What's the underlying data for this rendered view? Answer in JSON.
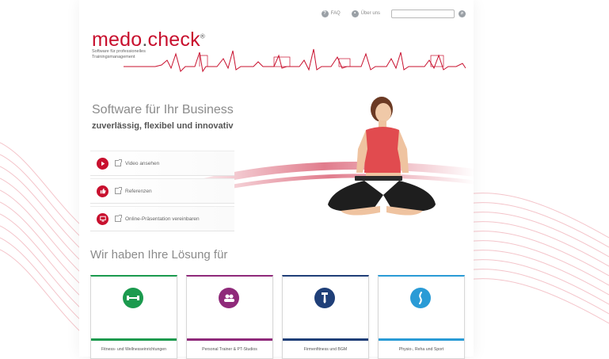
{
  "header": {
    "faq_label": "FAQ",
    "account_label": "Über uns",
    "search": {
      "value": "",
      "placeholder": ""
    }
  },
  "brand": {
    "logo_main": "medo",
    "logo_dot": ".",
    "logo_suffix": "check",
    "logo_mark": "®",
    "tagline_line1": "Software für professionelles",
    "tagline_line2": "Trainingsmanagement"
  },
  "hero": {
    "title": "Software für Ihr Business",
    "subtitle": "zuverlässig, flexibel und innovativ",
    "links": [
      {
        "label": "Video ansehen",
        "icon": "play-icon"
      },
      {
        "label": "Referenzen",
        "icon": "thumbs-up-icon"
      },
      {
        "label": "Online-Präsentation vereinbaren",
        "icon": "monitor-icon"
      }
    ]
  },
  "solutions": {
    "title": "Wir haben Ihre Lösung für",
    "cards": [
      {
        "label": "Fitness- und Wellnesseinrichtungen",
        "icon": "dumbbell-icon",
        "color": "#1b9a4e"
      },
      {
        "label": "Personal Trainer & PT-Studios",
        "icon": "people-icon",
        "color": "#8f2a7a"
      },
      {
        "label": "Firmenfitness und BGM",
        "icon": "tie-icon",
        "color": "#1f3f78"
      },
      {
        "label": "Physio-, Reha und Sport",
        "icon": "spine-icon",
        "color": "#2a9bd6"
      }
    ]
  },
  "colors": {
    "accent": "#c8102e"
  }
}
